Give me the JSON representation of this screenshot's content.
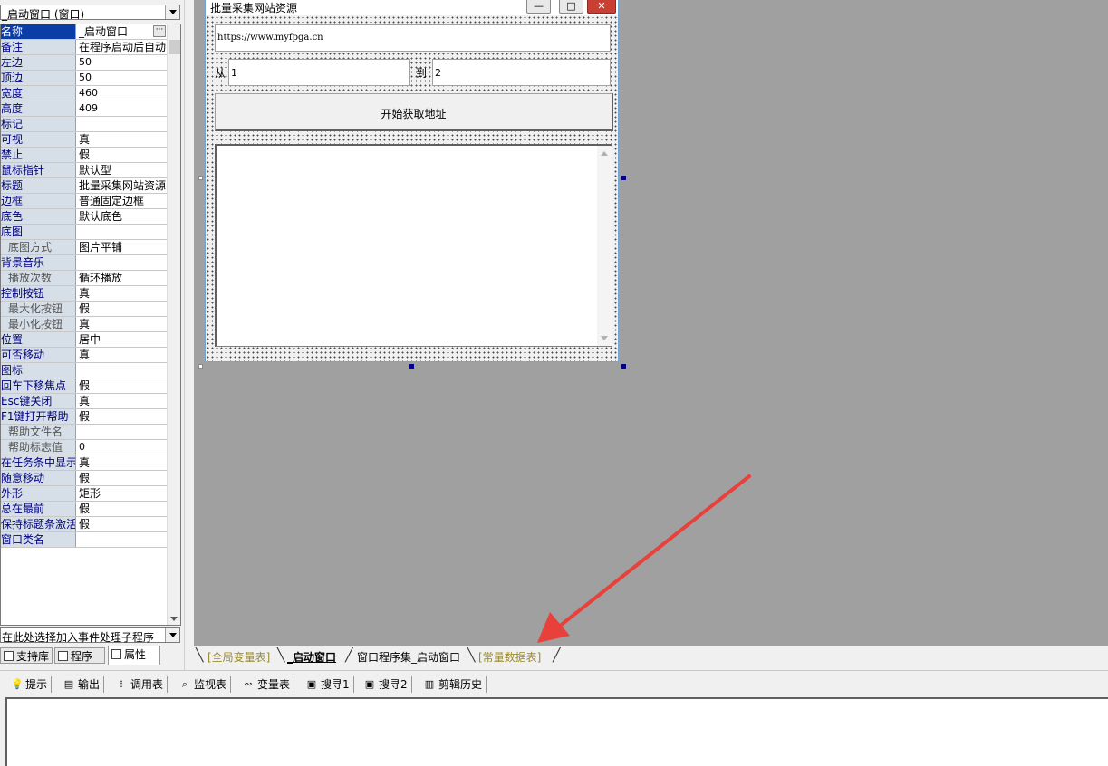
{
  "object_selector": {
    "value": "_启动窗口 (窗口)"
  },
  "properties": [
    {
      "name": "名称",
      "value": "_启动窗口",
      "selected": true,
      "has_button": true
    },
    {
      "name": "备注",
      "value": "在程序启动后自动"
    },
    {
      "name": "左边",
      "value": "50"
    },
    {
      "name": "顶边",
      "value": "50"
    },
    {
      "name": "宽度",
      "value": "460"
    },
    {
      "name": "高度",
      "value": "409"
    },
    {
      "name": "标记",
      "value": ""
    },
    {
      "name": "可视",
      "value": "真"
    },
    {
      "name": "禁止",
      "value": "假"
    },
    {
      "name": "鼠标指针",
      "value": "默认型"
    },
    {
      "name": "标题",
      "value": "批量采集网站资源"
    },
    {
      "name": "边框",
      "value": "普通固定边框"
    },
    {
      "name": "底色",
      "value": "默认底色"
    },
    {
      "name": "底图",
      "value": ""
    },
    {
      "name": "底图方式",
      "value": "图片平铺",
      "sub": true
    },
    {
      "name": "背景音乐",
      "value": ""
    },
    {
      "name": "播放次数",
      "value": "循环播放",
      "sub": true
    },
    {
      "name": "控制按钮",
      "value": "真"
    },
    {
      "name": "最大化按钮",
      "value": "假",
      "sub": true
    },
    {
      "name": "最小化按钮",
      "value": "真",
      "sub": true
    },
    {
      "name": "位置",
      "value": "居中"
    },
    {
      "name": "可否移动",
      "value": "真"
    },
    {
      "name": "图标",
      "value": ""
    },
    {
      "name": "回车下移焦点",
      "value": "假"
    },
    {
      "name": "Esc键关闭",
      "value": "真"
    },
    {
      "name": "F1键打开帮助",
      "value": "假"
    },
    {
      "name": "帮助文件名",
      "value": "",
      "sub": true
    },
    {
      "name": "帮助标志值",
      "value": "0",
      "sub": true
    },
    {
      "name": "在任务条中显示",
      "value": "真"
    },
    {
      "name": "随意移动",
      "value": "假"
    },
    {
      "name": "外形",
      "value": "矩形"
    },
    {
      "name": "总在最前",
      "value": "假"
    },
    {
      "name": "保持标题条激活",
      "value": "假"
    },
    {
      "name": "窗口类名",
      "value": ""
    }
  ],
  "event_selector": {
    "placeholder": "在此处选择加入事件处理子程序"
  },
  "left_tabs": [
    {
      "label": "支持库",
      "icon": "library-icon"
    },
    {
      "label": "程序",
      "icon": "program-icon"
    },
    {
      "label": "属性",
      "icon": "properties-icon",
      "active": true
    }
  ],
  "form": {
    "title": "批量采集网站资源",
    "controls": {
      "minimize": "—",
      "restore": "□",
      "close": "✕"
    },
    "url_value": "https://www.myfpga.cn",
    "from_label": "从",
    "from_value": "1",
    "to_label": "到",
    "to_value": "2",
    "start_button": "开始获取地址",
    "result_text": ""
  },
  "doc_tabs": [
    {
      "label": "[全局变量表]",
      "style": "dim"
    },
    {
      "label": "_启动窗口",
      "style": "active"
    },
    {
      "label": "窗口程序集_启动窗口",
      "style": "normal"
    },
    {
      "label": "[常量数据表]",
      "style": "dim"
    }
  ],
  "toolbar": [
    {
      "label": "提示",
      "icon": "lightbulb-icon"
    },
    {
      "label": "输出",
      "icon": "output-icon"
    },
    {
      "label": "调用表",
      "icon": "call-stack-icon"
    },
    {
      "label": "监视表",
      "icon": "watch-icon"
    },
    {
      "label": "变量表",
      "icon": "variables-icon"
    },
    {
      "label": "搜寻1",
      "icon": "search1-icon"
    },
    {
      "label": "搜寻2",
      "icon": "search2-icon"
    },
    {
      "label": "剪辑历史",
      "icon": "clip-history-icon"
    }
  ],
  "colors": {
    "design_bg": "#a0a0a0",
    "selection_blue": "#0a3ea6",
    "property_name_bg": "#d6dfe8",
    "annotation_arrow": "#e8403a",
    "dim_tab_text": "#9a8a2c"
  }
}
